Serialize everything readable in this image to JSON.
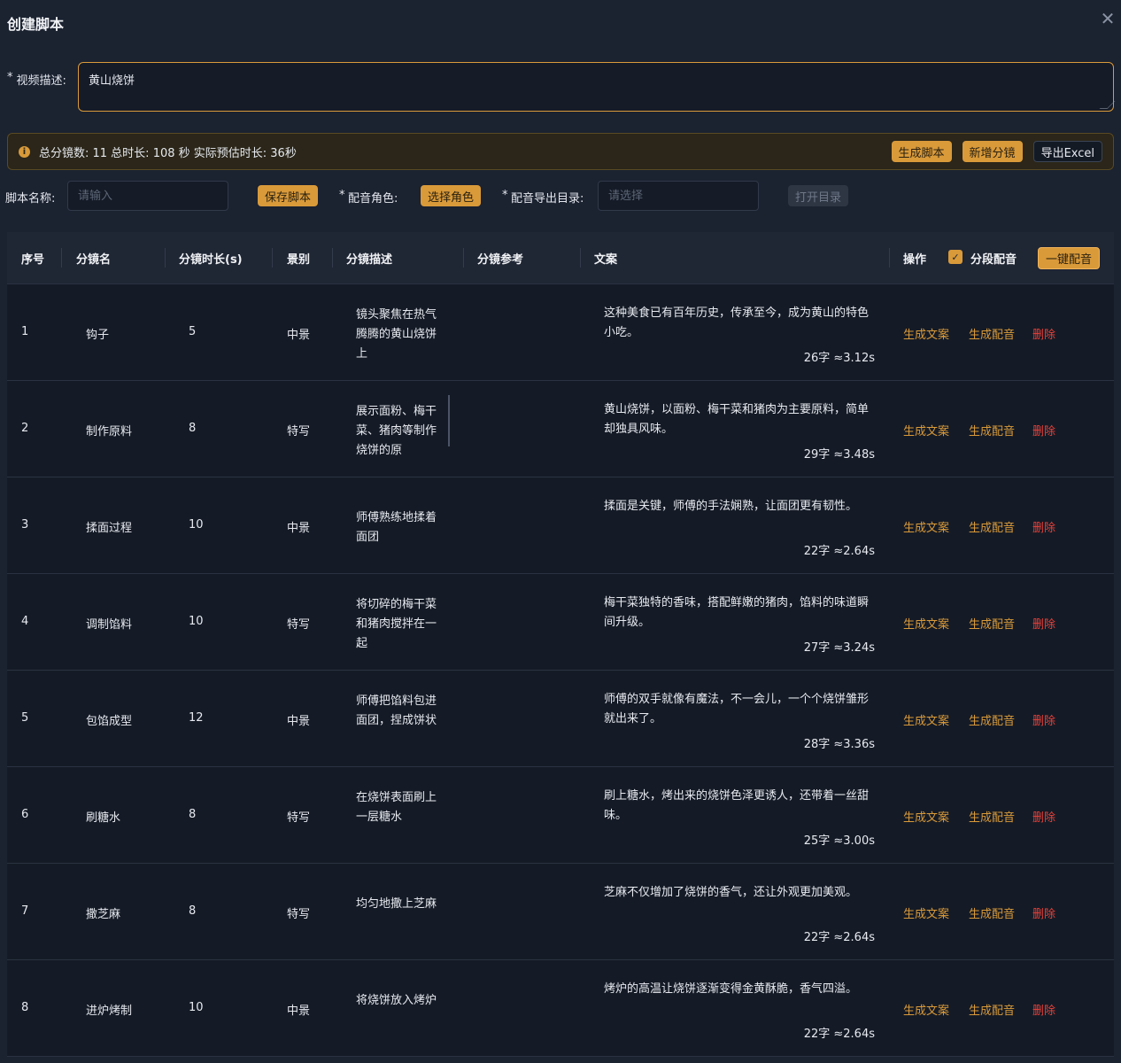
{
  "dialog": {
    "title": "创建脚本"
  },
  "desc": {
    "label": "视频描述:",
    "value": "黄山烧饼"
  },
  "alert": {
    "text": "总分镜数: 11 总时长: 108 秒 实际预估时长: 36秒",
    "btn_generate": "生成脚本",
    "btn_add": "新增分镜",
    "btn_export": "导出Excel"
  },
  "form": {
    "script_name_label": "脚本名称:",
    "script_name_placeholder": "请输入",
    "save_label": "保存脚本",
    "voice_role_label": "配音角色:",
    "voice_role_btn": "选择角色",
    "export_dir_label": "配音导出目录:",
    "export_dir_placeholder": "请选择",
    "open_dir": "打开目录"
  },
  "table": {
    "headers": {
      "index": "序号",
      "name": "分镜名",
      "duration": "分镜时长(s)",
      "shot": "景别",
      "desc": "分镜描述",
      "ref": "分镜参考",
      "copy": "文案",
      "ops": "操作",
      "seg_voice": "分段配音",
      "one_click": "一键配音"
    },
    "action_labels": {
      "gen_copy": "生成文案",
      "gen_voice": "生成配音",
      "delete": "删除"
    },
    "rows": [
      {
        "index": "1",
        "name": "钩子",
        "duration": "5",
        "shot": "中景",
        "desc": "镜头聚焦在热气腾腾的黄山烧饼上",
        "copy": "这种美食已有百年历史，传承至今，成为黄山的特色小吃。",
        "count": "26字 ≈3.12s"
      },
      {
        "index": "2",
        "name": "制作原料",
        "duration": "8",
        "shot": "特写",
        "desc": "展示面粉、梅干菜、猪肉等制作烧饼的原",
        "copy": "黄山烧饼，以面粉、梅干菜和猪肉为主要原料，简单却独具风味。",
        "count": "29字 ≈3.48s"
      },
      {
        "index": "3",
        "name": "揉面过程",
        "duration": "10",
        "shot": "中景",
        "desc": "师傅熟练地揉着面团",
        "copy": "揉面是关键，师傅的手法娴熟，让面团更有韧性。",
        "count": "22字 ≈2.64s"
      },
      {
        "index": "4",
        "name": "调制馅料",
        "duration": "10",
        "shot": "特写",
        "desc": "将切碎的梅干菜和猪肉搅拌在一起",
        "copy": "梅干菜独特的香味，搭配鲜嫩的猪肉，馅料的味道瞬间升级。",
        "count": "27字 ≈3.24s"
      },
      {
        "index": "5",
        "name": "包馅成型",
        "duration": "12",
        "shot": "中景",
        "desc": "师傅把馅料包进面团，捏成饼状",
        "copy": "师傅的双手就像有魔法，不一会儿，一个个烧饼雏形就出来了。",
        "count": "28字 ≈3.36s"
      },
      {
        "index": "6",
        "name": "刷糖水",
        "duration": "8",
        "shot": "特写",
        "desc": "在烧饼表面刷上一层糖水",
        "copy": "刷上糖水，烤出来的烧饼色泽更诱人，还带着一丝甜味。",
        "count": "25字 ≈3.00s"
      },
      {
        "index": "7",
        "name": "撒芝麻",
        "duration": "8",
        "shot": "特写",
        "desc": "均匀地撒上芝麻",
        "copy": "芝麻不仅增加了烧饼的香气，还让外观更加美观。",
        "count": "22字 ≈2.64s"
      },
      {
        "index": "8",
        "name": "进炉烤制",
        "duration": "10",
        "shot": "中景",
        "desc": "将烧饼放入烤炉",
        "copy": "烤炉的高温让烧饼逐渐变得金黄酥脆，香气四溢。",
        "count": "22字 ≈2.64s"
      }
    ]
  },
  "colors": {
    "accent": "#d99a3a",
    "danger": "#e8413a",
    "background": "#1b2230"
  }
}
